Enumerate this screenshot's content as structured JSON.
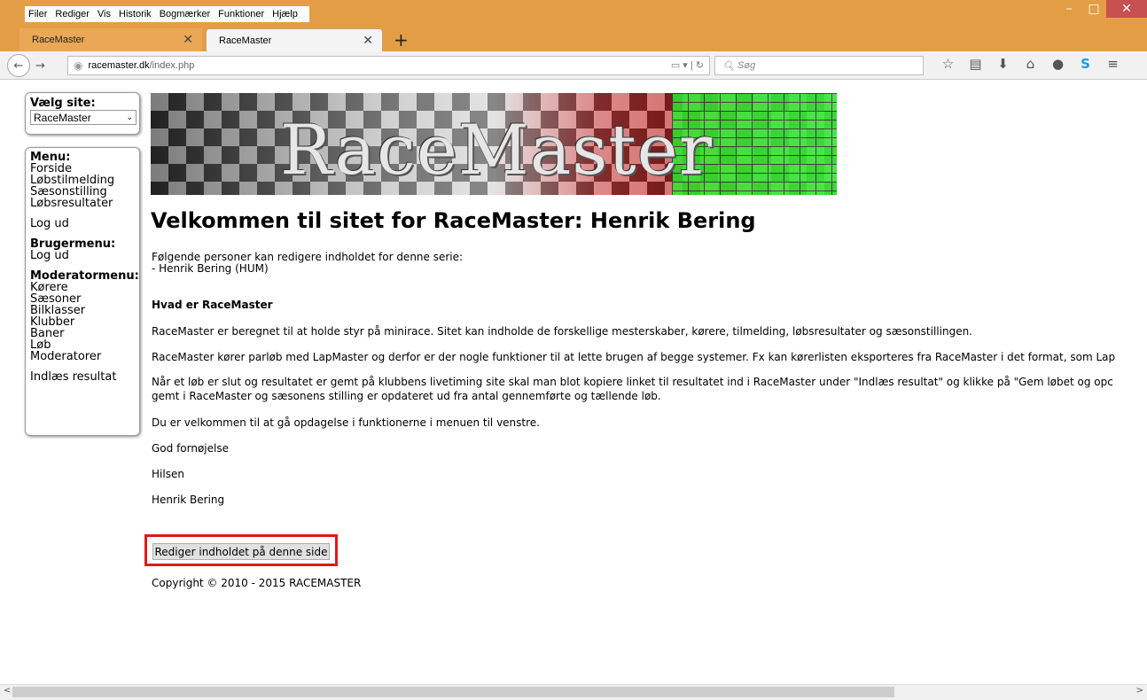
{
  "menubar": [
    "Filer",
    "Rediger",
    "Vis",
    "Historik",
    "Bogmærker",
    "Funktioner",
    "Hjælp"
  ],
  "tabs": [
    {
      "label": "RaceMaster"
    },
    {
      "label": "RaceMaster"
    }
  ],
  "url": {
    "host": "racemaster.dk",
    "path": "/index.php"
  },
  "search_placeholder": "Søg",
  "sidebar": {
    "site_label": "Vælg site:",
    "site_value": "RaceMaster",
    "menu_heading": "Menu:",
    "menu_items": [
      "Forside",
      "Løbstilmelding",
      "Sæsonstilling",
      "Løbsresultater"
    ],
    "logout1": "Log ud",
    "user_menu_heading": "Brugermenu:",
    "logout2": "Log ud",
    "mod_menu_heading": "Moderatormenu:",
    "mod_items": [
      "Kørere",
      "Sæsoner",
      "Bilklasser",
      "Klubber",
      "Baner",
      "Løb",
      "Moderatorer"
    ],
    "import": "Indlæs resultat"
  },
  "banner_title": "RaceMaster",
  "main": {
    "heading": "Velkommen til sitet for RaceMaster: Henrik Bering",
    "editors_intro": "Følgende personer kan redigere indholdet for denne serie:",
    "editors_list": "- Henrik Bering (HUM)",
    "what_heading": "Hvad er RaceMaster",
    "p1": "RaceMaster er beregnet til at holde styr på minirace. Sitet kan indholde de forskellige mesterskaber, kørere, tilmelding, løbsresultater og sæsonstillingen.",
    "p2": "RaceMaster kører parløb med LapMaster og derfor er der nogle funktioner til at lette brugen af begge systemer. Fx kan kørerlisten eksporteres fra RaceMaster i det format, som Lap",
    "p3a": "Når et løb er slut og resultatet er gemt på klubbens livetiming site skal man blot kopiere linket til resultatet ind i RaceMaster under \"Indlæs resultat\" og klikke på \"Gem løbet og opc",
    "p3b": "gemt i RaceMaster og sæsonens stilling er opdateret ud fra antal gennemførte og tællende løb.",
    "p4": "Du er velkommen til at gå opdagelse i funktionerne i menuen til venstre.",
    "p5": "God fornøjelse",
    "p6": "Hilsen",
    "p7": "Henrik Bering",
    "edit_button": "Rediger indholdet på denne side",
    "copyright": "Copyright © 2010 - 2015 RACEMASTER"
  }
}
